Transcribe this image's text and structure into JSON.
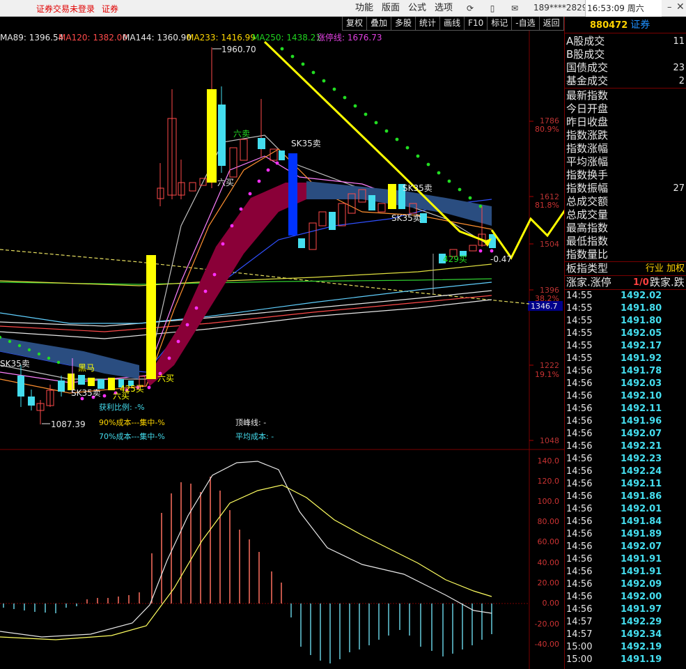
{
  "app": {
    "status_text": "证券交易未登录",
    "broker": "证券",
    "menus": [
      "功能",
      "版面",
      "公式",
      "选项"
    ],
    "user": "189****2829",
    "clock": "16:53:09 周六"
  },
  "toolbar": [
    "复权",
    "叠加",
    "多股",
    "统计",
    "画线",
    "F10",
    "标记",
    "-自选",
    "返回"
  ],
  "ma_legend": [
    {
      "text": "MA89: 1396.54",
      "color": "#e8e8e8"
    },
    {
      "text": "MA120: 1382.00",
      "color": "#ff4a4a"
    },
    {
      "text": "MA144: 1360.90",
      "color": "#e8e8e8"
    },
    {
      "text": "MA233: 1416.99",
      "color": "#ffd700"
    },
    {
      "text": "MA250: 1438.21",
      "color": "#1fd21f"
    },
    {
      "text": "涨停线: 1676.73",
      "color": "#e040e0"
    }
  ],
  "price_axis": {
    "levels": [
      "1786",
      "1612",
      "1504",
      "1396",
      "1222",
      "1048"
    ],
    "pcts": [
      "80.9%",
      "81.8%",
      "38.2%",
      "19.1%"
    ],
    "current": "1346.7"
  },
  "annotations": {
    "high": "1960.70",
    "low": "1087.39",
    "signals": [
      "六卖",
      "SK35卖",
      "六买",
      "SK35卖",
      "SK35卖",
      "429买",
      "-0.47",
      "SK35卖",
      "黑马",
      "SK35卖",
      "425买",
      "六买",
      "六买"
    ]
  },
  "stats": {
    "profit_ratio": "获利比例: -%",
    "cost90": "90%成本---集中-%",
    "cost70": "70%成本---集中-%",
    "peak_line": "顶峰线: -",
    "avg_cost": "平均成本: -"
  },
  "macd_axis": [
    "140.0",
    "120.0",
    "100.0",
    "80.00",
    "60.00",
    "40.00",
    "20.00",
    "0.00",
    "-20.00",
    "-40.00"
  ],
  "right_panel": {
    "code": "880472",
    "name": "证券",
    "rows_a": [
      {
        "label": "A股成交",
        "value": "11"
      },
      {
        "label": "B股成交",
        "value": ""
      },
      {
        "label": "国债成交",
        "value": "23"
      },
      {
        "label": "基金成交",
        "value": "2"
      }
    ],
    "rows_b": [
      {
        "label": "最新指数",
        "value": ""
      },
      {
        "label": "今日开盘",
        "value": ""
      },
      {
        "label": "昨日收盘",
        "value": ""
      },
      {
        "label": "指数涨跌",
        "value": ""
      },
      {
        "label": "指数涨幅",
        "value": ""
      },
      {
        "label": "平均涨幅",
        "value": ""
      },
      {
        "label": "指数换手",
        "value": ""
      },
      {
        "label": "指数振幅",
        "value": "27"
      },
      {
        "label": "总成交额",
        "value": ""
      },
      {
        "label": "总成交量",
        "value": ""
      },
      {
        "label": "最高指数",
        "value": ""
      },
      {
        "label": "最低指数",
        "value": ""
      },
      {
        "label": "指数量比",
        "value": ""
      }
    ],
    "board_type_label": "板指类型",
    "board_type_value": "行业 加权",
    "updown_left": "涨家.涨停",
    "updown_mid": "1/0",
    "updown_right": "跌家.跌",
    "ticks": [
      [
        "14:55",
        "1492.02"
      ],
      [
        "14:55",
        "1491.80"
      ],
      [
        "14:55",
        "1491.80"
      ],
      [
        "14:55",
        "1492.05"
      ],
      [
        "14:55",
        "1492.17"
      ],
      [
        "14:55",
        "1491.92"
      ],
      [
        "14:56",
        "1491.78"
      ],
      [
        "14:56",
        "1492.03"
      ],
      [
        "14:56",
        "1492.10"
      ],
      [
        "14:56",
        "1492.11"
      ],
      [
        "14:56",
        "1491.96"
      ],
      [
        "14:56",
        "1492.07"
      ],
      [
        "14:56",
        "1492.21"
      ],
      [
        "14:56",
        "1492.23"
      ],
      [
        "14:56",
        "1492.24"
      ],
      [
        "14:56",
        "1492.11"
      ],
      [
        "14:56",
        "1491.86"
      ],
      [
        "14:56",
        "1492.01"
      ],
      [
        "14:56",
        "1491.84"
      ],
      [
        "14:56",
        "1491.89"
      ],
      [
        "14:56",
        "1492.07"
      ],
      [
        "14:56",
        "1491.91"
      ],
      [
        "14:56",
        "1491.91"
      ],
      [
        "14:56",
        "1492.09"
      ],
      [
        "14:56",
        "1492.00"
      ],
      [
        "14:56",
        "1491.97"
      ],
      [
        "14:57",
        "1492.29"
      ],
      [
        "14:57",
        "1492.34"
      ],
      [
        "15:00",
        "1492.19"
      ],
      [
        "15:00",
        "1491.19"
      ]
    ]
  }
}
